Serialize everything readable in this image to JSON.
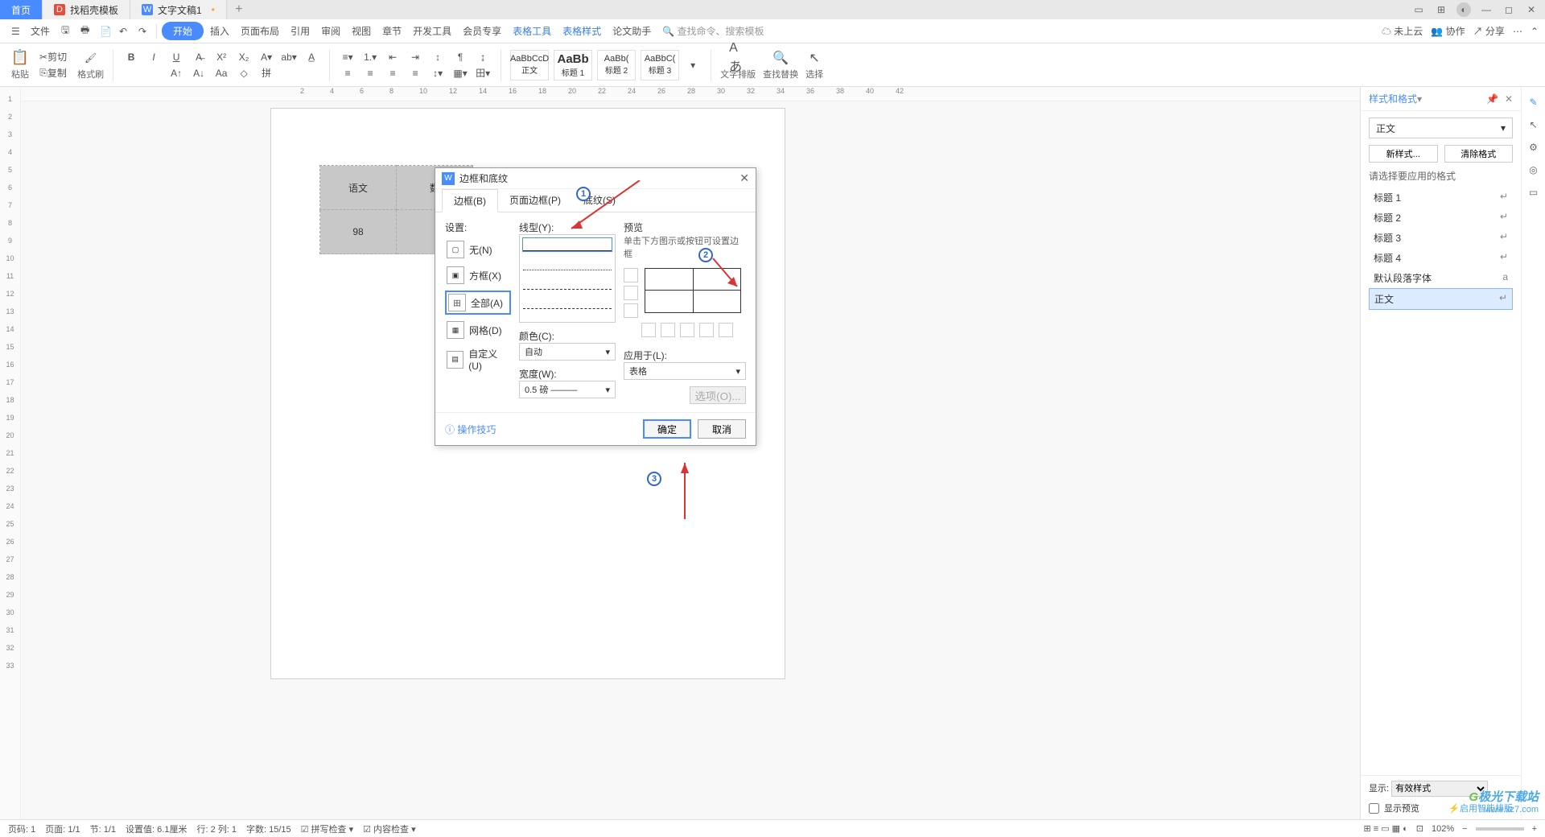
{
  "titlebar": {
    "tabs": [
      {
        "label": "首页"
      },
      {
        "label": "找稻壳模板"
      },
      {
        "label": "文字文稿1"
      }
    ]
  },
  "menubar": {
    "file": "文件",
    "items": [
      "开始",
      "插入",
      "页面布局",
      "引用",
      "审阅",
      "视图",
      "章节",
      "开发工具",
      "会员专享",
      "表格工具",
      "表格样式",
      "论文助手"
    ],
    "search_hint": "查找命令、搜索模板",
    "cloud": "未上云",
    "collab": "协作",
    "share": "分享"
  },
  "toolbar": {
    "paste": "粘贴",
    "cut": "剪切",
    "copy": "复制",
    "format_painter": "格式刷",
    "styles": [
      {
        "sample": "AaBbCcD",
        "label": "正文"
      },
      {
        "sample": "AaBb",
        "label": "标题 1"
      },
      {
        "sample": "AaBb(",
        "label": "标题 2"
      },
      {
        "sample": "AaBbC(",
        "label": "标题 3"
      }
    ],
    "text_layout": "文字排版",
    "find_replace": "查找替换",
    "select": "选择"
  },
  "doc_table": {
    "r1": [
      "语文",
      "数"
    ],
    "r2": [
      "98",
      ""
    ]
  },
  "dialog": {
    "title": "边框和底纹",
    "tabs": [
      "边框(B)",
      "页面边框(P)",
      "底纹(S)"
    ],
    "settings_label": "设置:",
    "settings": [
      "无(N)",
      "方框(X)",
      "全部(A)",
      "网格(D)",
      "自定义(U)"
    ],
    "line_label": "线型(Y):",
    "color_label": "颜色(C):",
    "color_value": "自动",
    "width_label": "宽度(W):",
    "width_value": "0.5  磅 ———",
    "preview_label": "预览",
    "preview_hint": "单击下方图示或按钮可设置边框",
    "apply_label": "应用于(L):",
    "apply_value": "表格",
    "options_btn": "选项(O)...",
    "tips": "操作技巧",
    "ok": "确定",
    "cancel": "取消"
  },
  "right_panel": {
    "title": "样式和格式",
    "current": "正文",
    "new_btn": "新样式...",
    "clear_btn": "清除格式",
    "note": "请选择要应用的格式",
    "items": [
      "标题 1",
      "标题 2",
      "标题 3",
      "标题 4",
      "默认段落字体",
      "正文"
    ],
    "show_label": "显示:",
    "show_value": "有效样式",
    "preview_chk": "显示预览",
    "enable_link": "启用智能排版"
  },
  "statusbar": {
    "items": [
      "页码: 1",
      "页面: 1/1",
      "节: 1/1",
      "设置值: 6.1厘米",
      "行: 2  列: 1",
      "字数: 15/15",
      "拼写检查",
      "内容检查"
    ],
    "zoom": "102%"
  },
  "watermark": {
    "brand": "极光下载站",
    "url": "www.xz7.com"
  }
}
